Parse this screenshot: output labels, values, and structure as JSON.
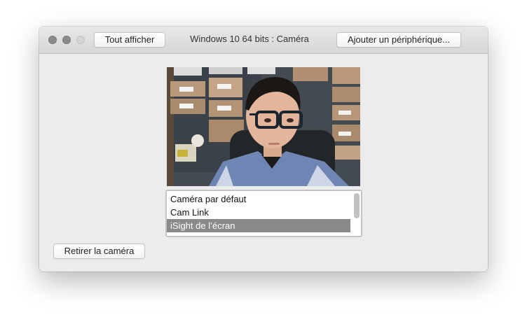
{
  "window": {
    "title": "Windows 10 64 bits : Caméra"
  },
  "toolbar": {
    "show_all_label": "Tout afficher",
    "add_device_label": "Ajouter un périphérique..."
  },
  "camera_list": {
    "items": [
      {
        "label": "Caméra par défaut",
        "selected": false
      },
      {
        "label": "Cam Link",
        "selected": false
      },
      {
        "label": "iSight de l’écran",
        "selected": true
      }
    ]
  },
  "footer": {
    "remove_label": "Retirer la caméra"
  },
  "colors": {
    "window_bg": "#ececec",
    "selection_bg": "#8a8a8a",
    "selection_text": "#ffffff"
  }
}
